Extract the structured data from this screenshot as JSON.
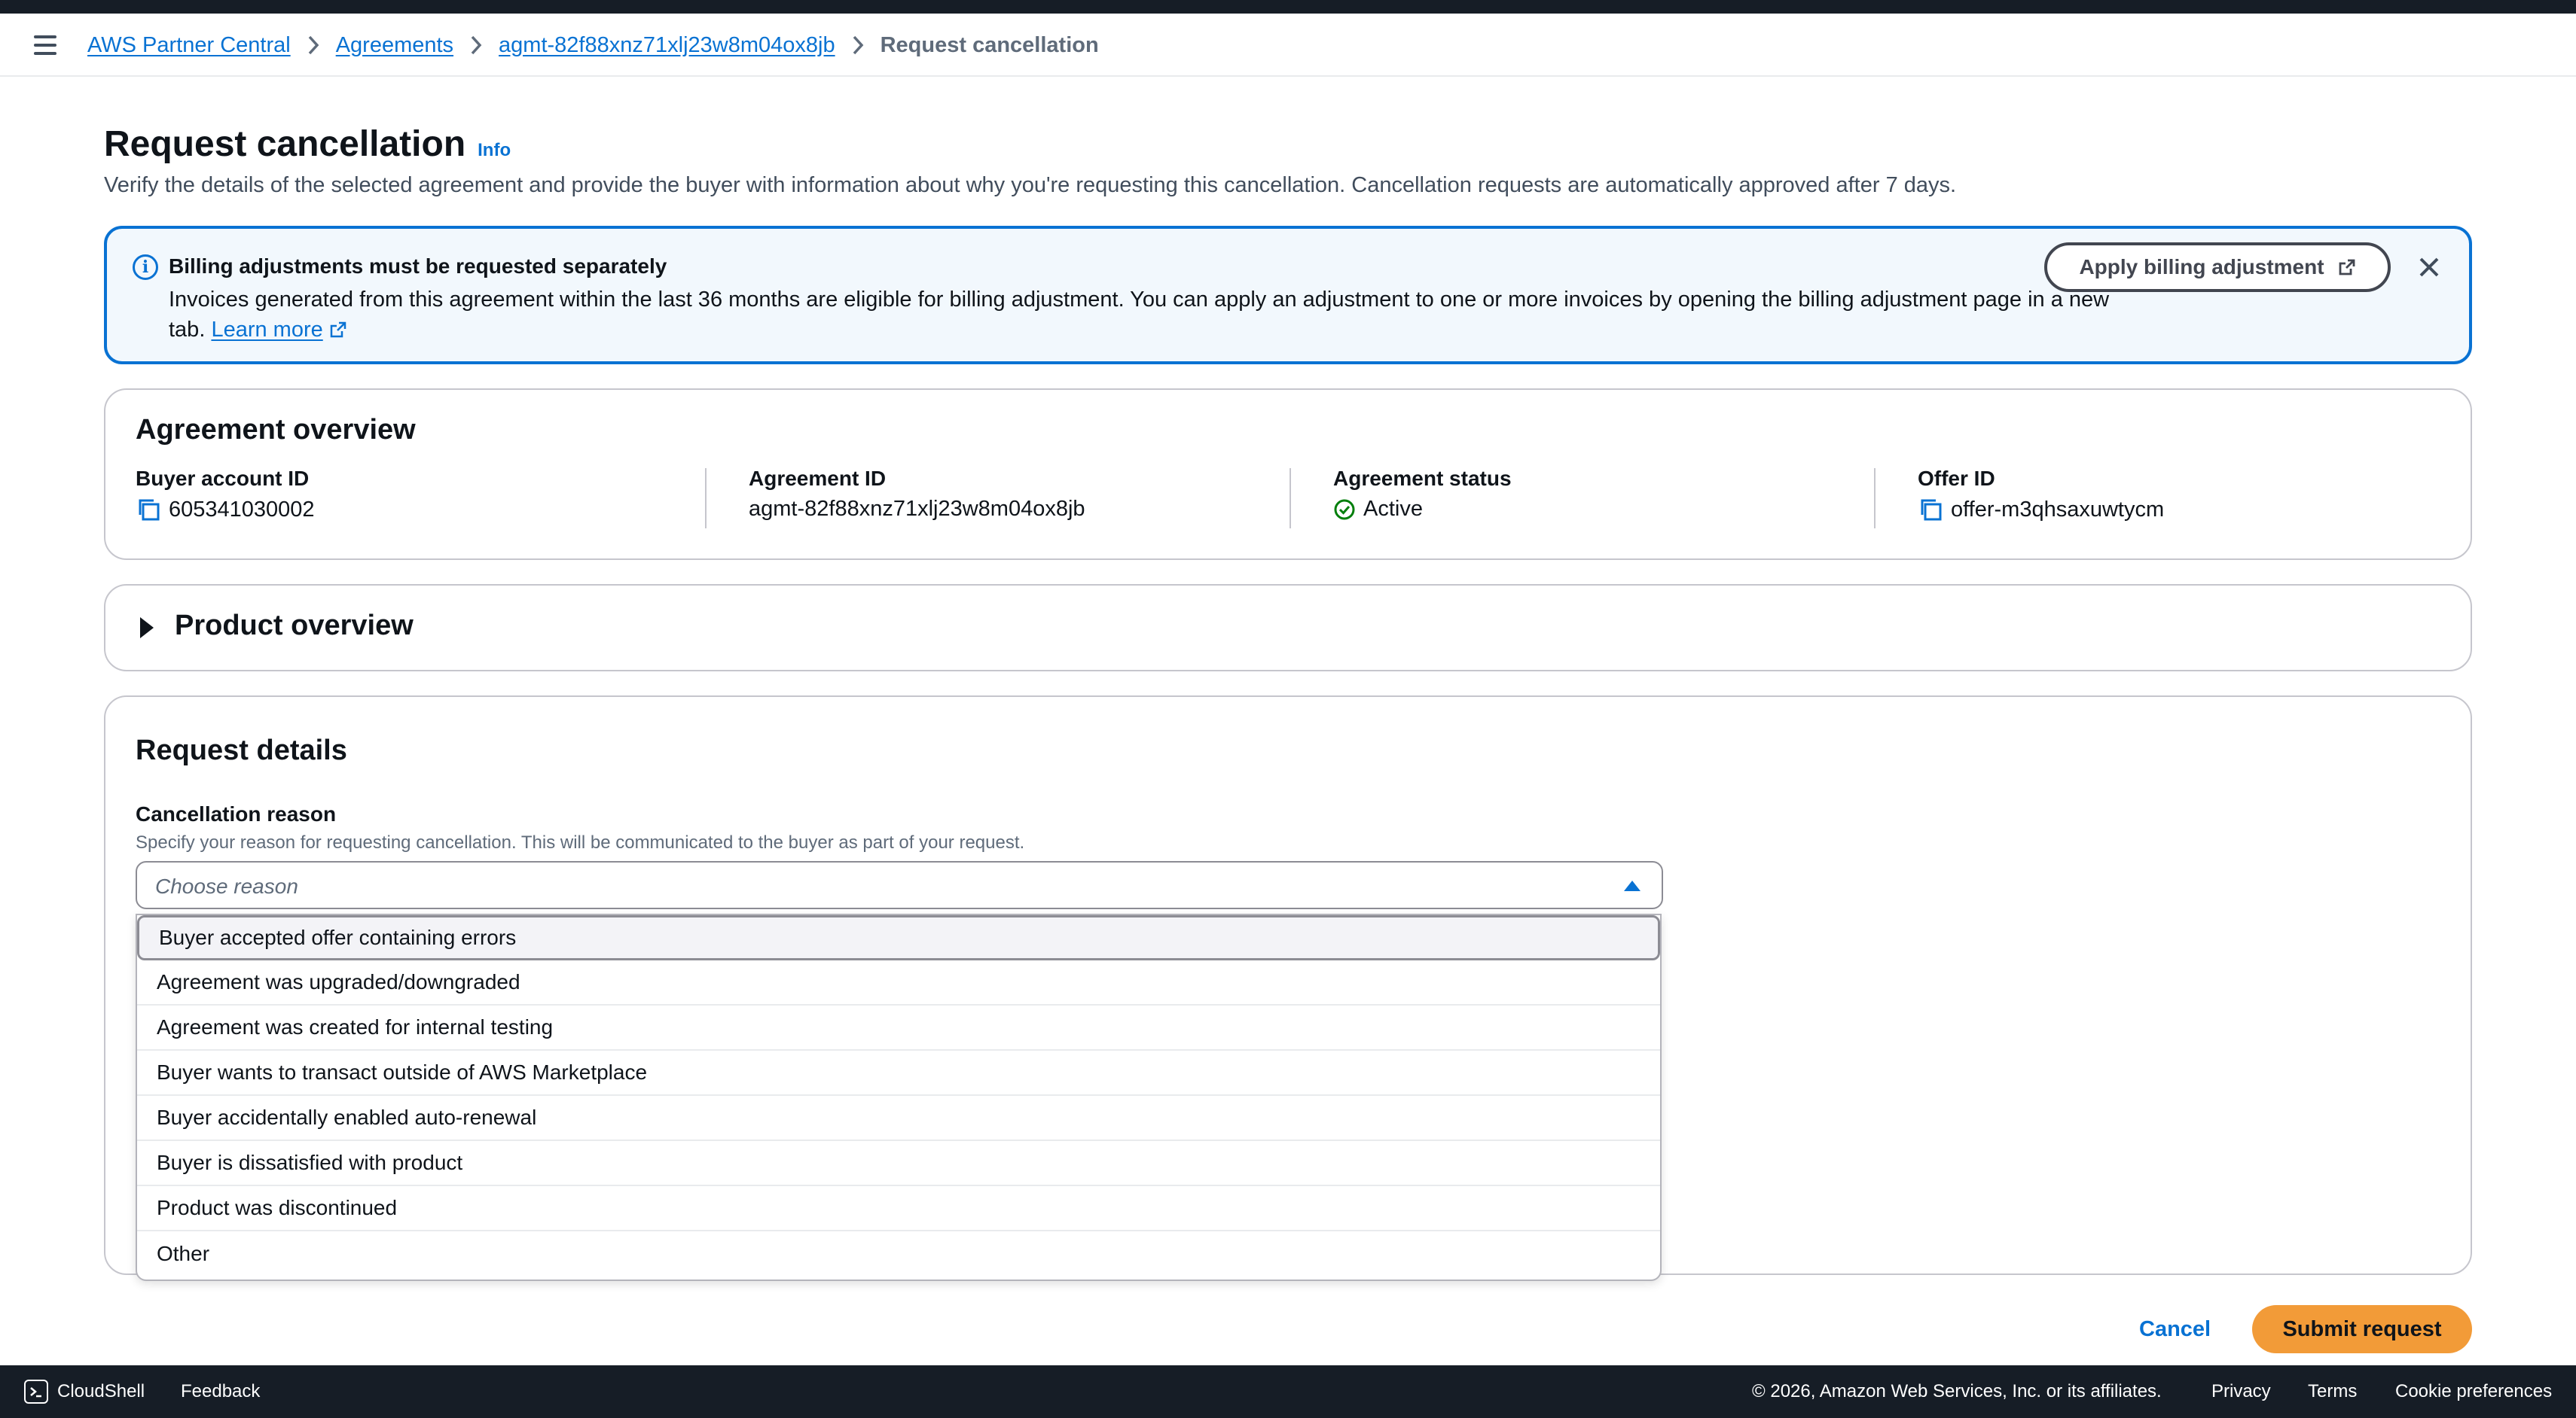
{
  "breadcrumb": {
    "items": [
      "AWS Partner Central",
      "Agreements",
      "agmt-82f88xnz71xlj23w8m04ox8jb"
    ],
    "current": "Request cancellation"
  },
  "page": {
    "title": "Request cancellation",
    "info_label": "Info",
    "description": "Verify the details of the selected agreement and provide the buyer with information about why you're requesting this cancellation. Cancellation requests are automatically approved after 7 days."
  },
  "alert": {
    "title": "Billing adjustments must be requested separately",
    "body": "Invoices generated from this agreement within the last 36 months are eligible for billing adjustment. You can apply an adjustment to one or more invoices by opening the billing adjustment page in a new tab.",
    "learn_more": "Learn more",
    "button": "Apply billing adjustment"
  },
  "overview": {
    "title": "Agreement overview",
    "buyer_account_label": "Buyer account ID",
    "buyer_account_value": "605341030002",
    "agreement_id_label": "Agreement ID",
    "agreement_id_value": "agmt-82f88xnz71xlj23w8m04ox8jb",
    "status_label": "Agreement status",
    "status_value": "Active",
    "offer_id_label": "Offer ID",
    "offer_id_value": "offer-m3qhsaxuwtycm"
  },
  "product_overview": {
    "title": "Product overview"
  },
  "request": {
    "title": "Request details",
    "reason_label": "Cancellation reason",
    "reason_desc": "Specify your reason for requesting cancellation. This will be communicated to the buyer as part of your request.",
    "reason_placeholder": "Choose reason",
    "options": [
      "Buyer accepted offer containing errors",
      "Agreement was upgraded/downgraded",
      "Agreement was created for internal testing",
      "Buyer wants to transact outside of AWS Marketplace",
      "Buyer accidentally enabled auto-renewal",
      "Buyer is dissatisfied with product",
      "Product was discontinued",
      "Other"
    ]
  },
  "actions": {
    "cancel": "Cancel",
    "submit": "Submit request"
  },
  "footer": {
    "cloudshell": "CloudShell",
    "feedback": "Feedback",
    "copyright": "© 2026, Amazon Web Services, Inc. or its affiliates.",
    "privacy": "Privacy",
    "terms": "Terms",
    "cookies": "Cookie preferences"
  },
  "colors": {
    "link": "#0972d3",
    "primary_button": "#f29b38",
    "success": "#037f0c",
    "dark_bar": "#161d26"
  }
}
